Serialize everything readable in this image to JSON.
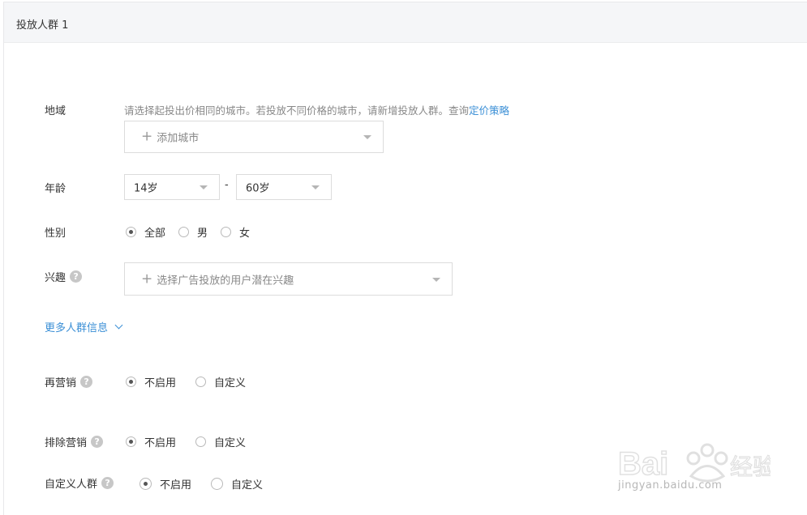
{
  "panel": {
    "title": "投放人群 1"
  },
  "region": {
    "label": "地域",
    "hint": "请选择起投出价相同的城市。若投放不同价格的城市，请新增投放人群。查询",
    "hint_link": "定价策略",
    "select_placeholder": "添加城市"
  },
  "age": {
    "label": "年龄",
    "from": "14岁",
    "separator": "-",
    "to": "60岁"
  },
  "gender": {
    "label": "性别",
    "options": [
      "全部",
      "男",
      "女"
    ],
    "selected": "全部"
  },
  "interest": {
    "label": "兴趣",
    "select_placeholder": "选择广告投放的用户潜在兴趣"
  },
  "more": {
    "label": "更多人群信息"
  },
  "remarketing": {
    "label": "再营销",
    "options": [
      "不启用",
      "自定义"
    ],
    "selected": "不启用"
  },
  "exclude": {
    "label": "排除营销",
    "options": [
      "不启用",
      "自定义"
    ],
    "selected": "不启用"
  },
  "custom": {
    "label": "自定义人群",
    "options": [
      "不启用",
      "自定义"
    ],
    "selected": "不启用"
  },
  "help_glyph": "?",
  "plus_glyph": "+",
  "watermark": {
    "text": "jingyan.baidu.com"
  },
  "colors": {
    "link": "#3b8fd6",
    "header_bg": "#f5f6f8",
    "border": "#dcdcdc"
  }
}
